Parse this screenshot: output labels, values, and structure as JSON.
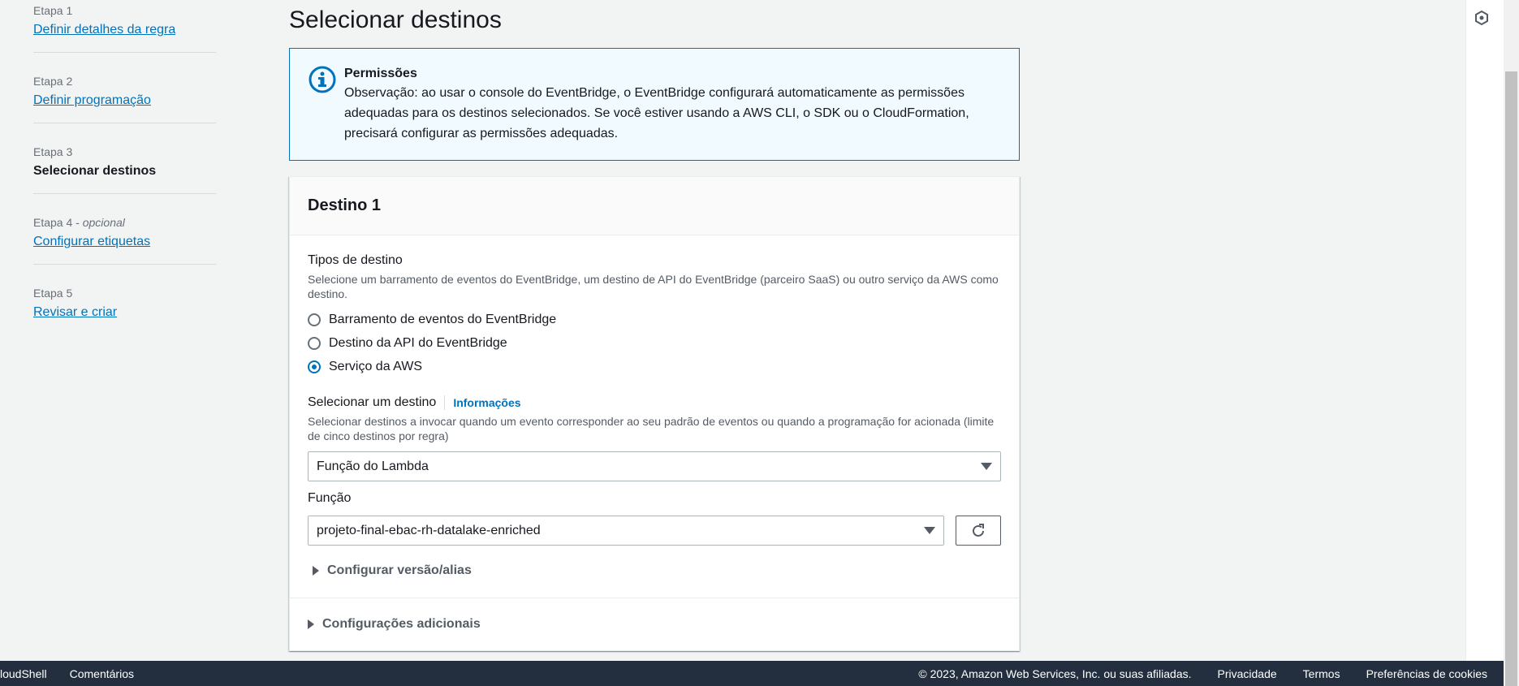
{
  "steps": [
    {
      "num": "Etapa 1",
      "label": "Definir detalhes da regra",
      "current": false
    },
    {
      "num": "Etapa 2",
      "label": "Definir programação",
      "current": false
    },
    {
      "num": "Etapa 3",
      "label": "Selecionar destinos",
      "current": true
    },
    {
      "num": "Etapa 4",
      "optional": "opcional",
      "label": "Configurar etiquetas",
      "current": false
    },
    {
      "num": "Etapa 5",
      "label": "Revisar e criar",
      "current": false
    }
  ],
  "page_title": "Selecionar destinos",
  "alert": {
    "title": "Permissões",
    "text": "Observação: ao usar o console do EventBridge, o EventBridge configurará automaticamente as permissões adequadas para os destinos selecionados. Se você estiver usando a AWS CLI, o SDK ou o CloudFormation, precisará configurar as permissões adequadas."
  },
  "panel": {
    "title": "Destino 1",
    "target_types": {
      "label": "Tipos de destino",
      "desc": "Selecione um barramento de eventos do EventBridge, um destino de API do EventBridge (parceiro SaaS) ou outro serviço da AWS como destino.",
      "options": [
        {
          "label": "Barramento de eventos do EventBridge",
          "checked": false
        },
        {
          "label": "Destino da API do EventBridge",
          "checked": false
        },
        {
          "label": "Serviço da AWS",
          "checked": true
        }
      ]
    },
    "select_target": {
      "label": "Selecionar um destino",
      "info": "Informações",
      "desc": "Selecionar destinos a invocar quando um evento corresponder ao seu padrão de eventos ou quando a programação for acionada (limite de cinco destinos por regra)",
      "value": "Função do Lambda"
    },
    "function": {
      "label": "Função",
      "value": "projeto-final-ebac-rh-datalake-enriched"
    },
    "version_alias": "Configurar versão/alias",
    "additional": "Configurações adicionais"
  },
  "footer": {
    "cloudshell": "loudShell",
    "feedback": "Comentários",
    "copyright": "© 2023, Amazon Web Services, Inc. ou suas afiliadas.",
    "privacy": "Privacidade",
    "terms": "Termos",
    "cookies": "Preferências de cookies"
  },
  "colors": {
    "link": "#0073bb",
    "footer_bg": "#232f3e",
    "alert_bg": "#f1faff"
  }
}
